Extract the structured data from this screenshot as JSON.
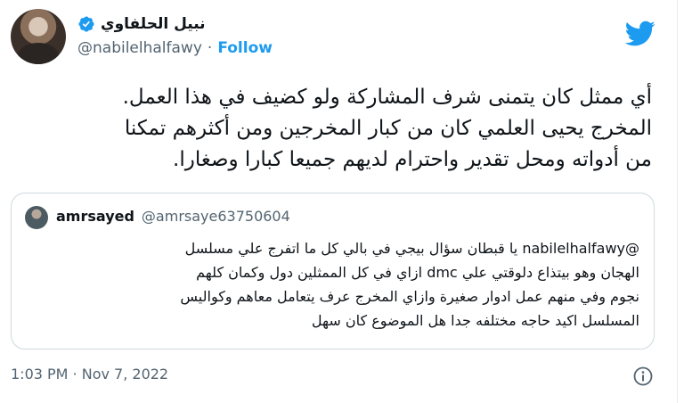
{
  "author": {
    "display_name": "نبيل الحلفاوي",
    "handle": "@nabilelhalfawy",
    "separator": "·",
    "follow_label": "Follow"
  },
  "tweet": {
    "lines": [
      "أي ممثل كان يتمنى شرف المشاركة ولو كضيف في هذا العمل.",
      "المخرج يحيى العلمي كان من كبار المخرجين ومن أكثرهم تمكنا",
      "من أدواته ومحل تقدير واحترام لديهم جميعا كبارا وصغارا."
    ]
  },
  "quoted": {
    "display_name": "amrsayed",
    "handle": "@amrsaye63750604",
    "lines": [
      "@nabilelhalfawy يا قبطان سؤال بيجي في بالي كل ما اتفرج علي مسلسل",
      "الهجان وهو بيتذاع دلوقتي علي dmc ازاي في كل الممثلين دول وكمان كلهم",
      "نجوم وفي منهم عمل ادوار صغيرة وازاي المخرج عرف يتعامل معاهم وكواليس",
      "المسلسل اكيد حاجه مختلفه جدا هل الموضوع كان سهل"
    ]
  },
  "footer": {
    "timestamp": "1:03 PM · Nov 7, 2022"
  },
  "icons": {
    "verified": "verified-badge-icon",
    "brand": "twitter-bird-icon",
    "info": "info-icon"
  },
  "colors": {
    "accent": "#1d9bf0",
    "secondary_text": "#536471",
    "border": "#cfd9de"
  }
}
